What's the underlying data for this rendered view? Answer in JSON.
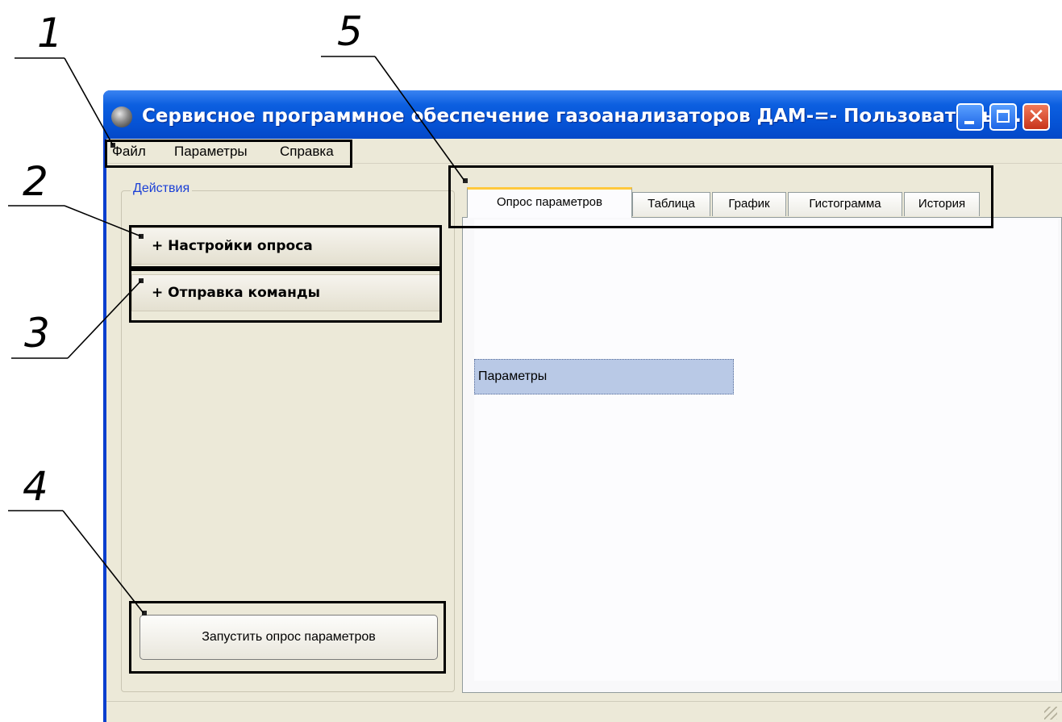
{
  "window": {
    "title": "Сервисное программное обеспечение газоанализаторов ДАМ-=- Пользователь: ..."
  },
  "menu": [
    "Файл",
    "Параметры",
    "Справка"
  ],
  "left_panel": {
    "group_title": "Действия",
    "sections": [
      "+ Настройки опроса",
      "+ Отправка команды"
    ],
    "start_button": "Запустить опрос параметров"
  },
  "tabs": [
    "Опрос параметров",
    "Таблица",
    "График",
    "Гистограмма",
    "История"
  ],
  "active_tab": "Опрос параметров",
  "panel": {
    "item": "Параметры"
  },
  "callouts": [
    "1",
    "2",
    "3",
    "4",
    "5"
  ]
}
